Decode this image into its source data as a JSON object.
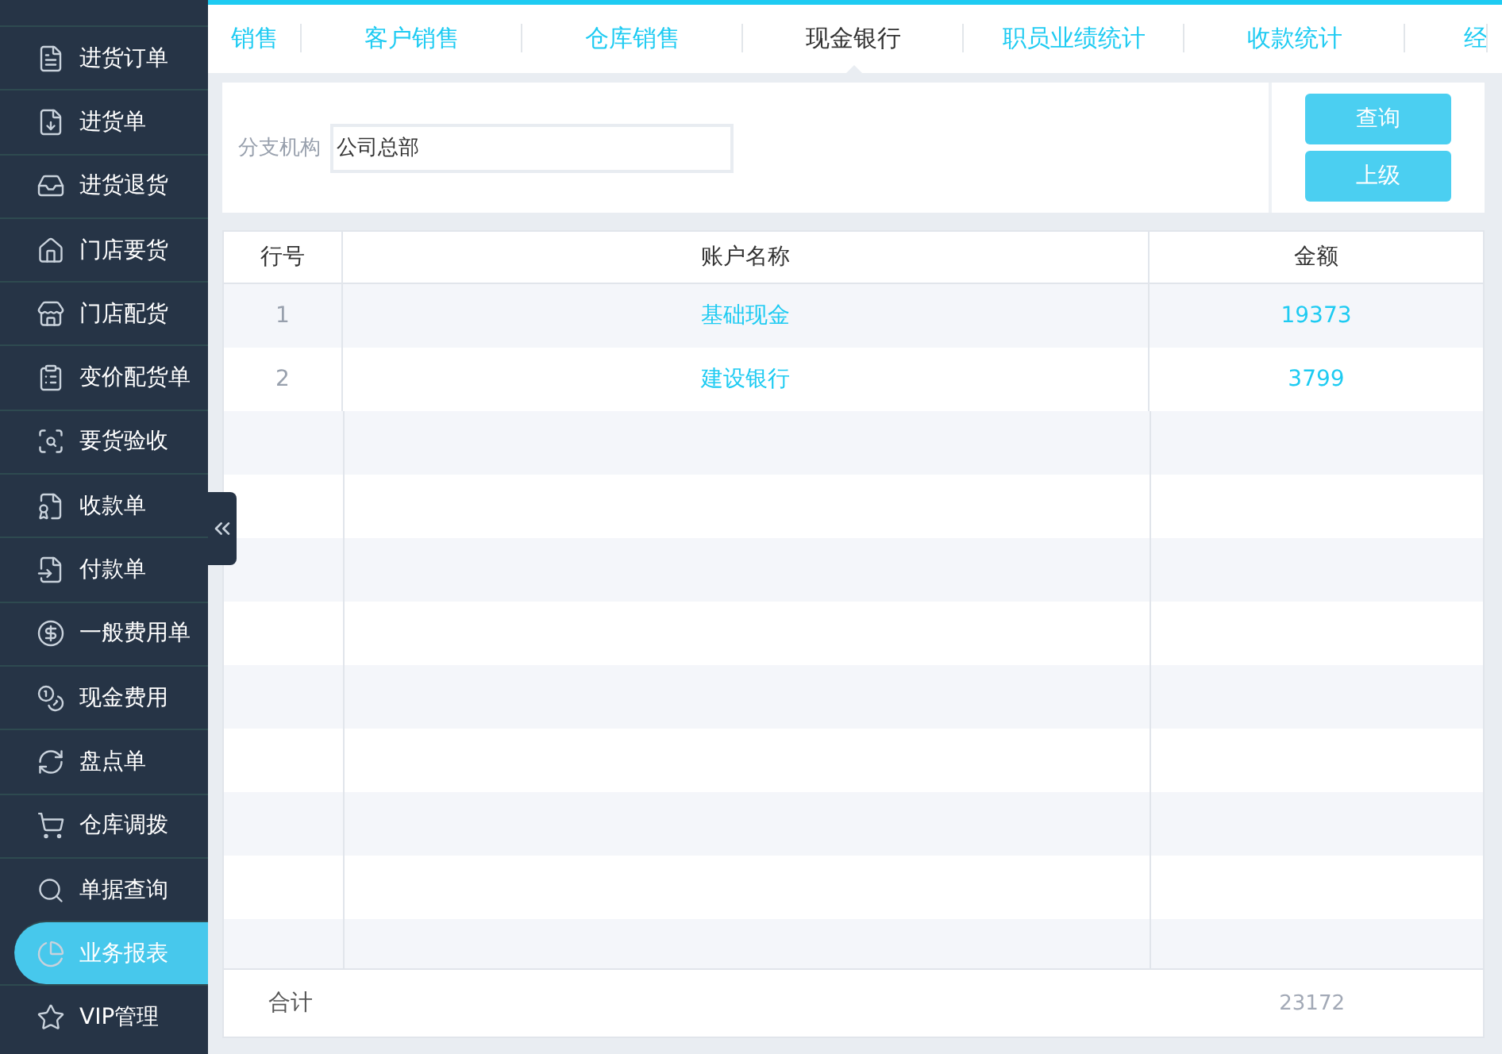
{
  "sidebar": {
    "items": [
      {
        "label": "进货订单",
        "selected": false
      },
      {
        "label": "进货单",
        "selected": false
      },
      {
        "label": "进货退货",
        "selected": false
      },
      {
        "label": "门店要货",
        "selected": false
      },
      {
        "label": "门店配货",
        "selected": false
      },
      {
        "label": "变价配货单",
        "selected": false
      },
      {
        "label": "要货验收",
        "selected": false
      },
      {
        "label": "收款单",
        "selected": false
      },
      {
        "label": "付款单",
        "selected": false
      },
      {
        "label": "一般费用单",
        "selected": false
      },
      {
        "label": "现金费用",
        "selected": false
      },
      {
        "label": "盘点单",
        "selected": false
      },
      {
        "label": "仓库调拨",
        "selected": false
      },
      {
        "label": "单据查询",
        "selected": false
      },
      {
        "label": "业务报表",
        "selected": true
      },
      {
        "label": "VIP管理",
        "selected": false
      }
    ]
  },
  "tabs": [
    {
      "label": "销售",
      "selected": false
    },
    {
      "label": "客户销售",
      "selected": false
    },
    {
      "label": "仓库销售",
      "selected": false
    },
    {
      "label": "现金银行",
      "selected": true
    },
    {
      "label": "职员业绩统计",
      "selected": false
    },
    {
      "label": "收款统计",
      "selected": false
    },
    {
      "label": "经",
      "selected": false
    }
  ],
  "filter": {
    "label": "分支机构",
    "value": "公司总部"
  },
  "buttons": [
    "查询",
    "上级"
  ],
  "table": {
    "columns": [
      "行号",
      "账户名称",
      "金额"
    ],
    "rows": [
      {
        "index": "1",
        "account": "基础现金",
        "amount": "19373"
      },
      {
        "index": "2",
        "account": "建设银行",
        "amount": "3799"
      }
    ],
    "footer": {
      "label": "合计",
      "total": "23172"
    }
  }
}
